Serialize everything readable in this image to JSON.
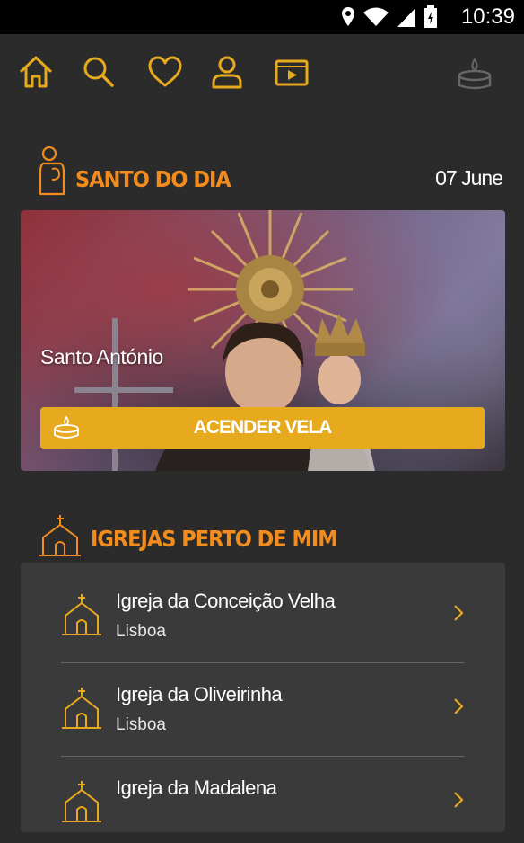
{
  "status_bar": {
    "time": "10:39"
  },
  "toolbar": {
    "icons": [
      "home-icon",
      "search-icon",
      "heart-icon",
      "profile-icon",
      "video-icon",
      "candle-icon"
    ]
  },
  "saint_of_day": {
    "title": "SANTO DO DIA",
    "date": "07 June",
    "saint_name": "Santo António",
    "button_label": "ACENDER VELA"
  },
  "churches": {
    "title": "IGREJAS PERTO DE MIM",
    "items": [
      {
        "name": "Igreja da Conceição Velha",
        "city": "Lisboa"
      },
      {
        "name": "Igreja da Oliveirinha",
        "city": "Lisboa"
      },
      {
        "name": "Igreja da Madalena",
        "city": ""
      }
    ]
  },
  "colors": {
    "accent_orange": "#f28c1e",
    "button_gold": "#e7a91d",
    "bg": "#2b2b2b"
  }
}
